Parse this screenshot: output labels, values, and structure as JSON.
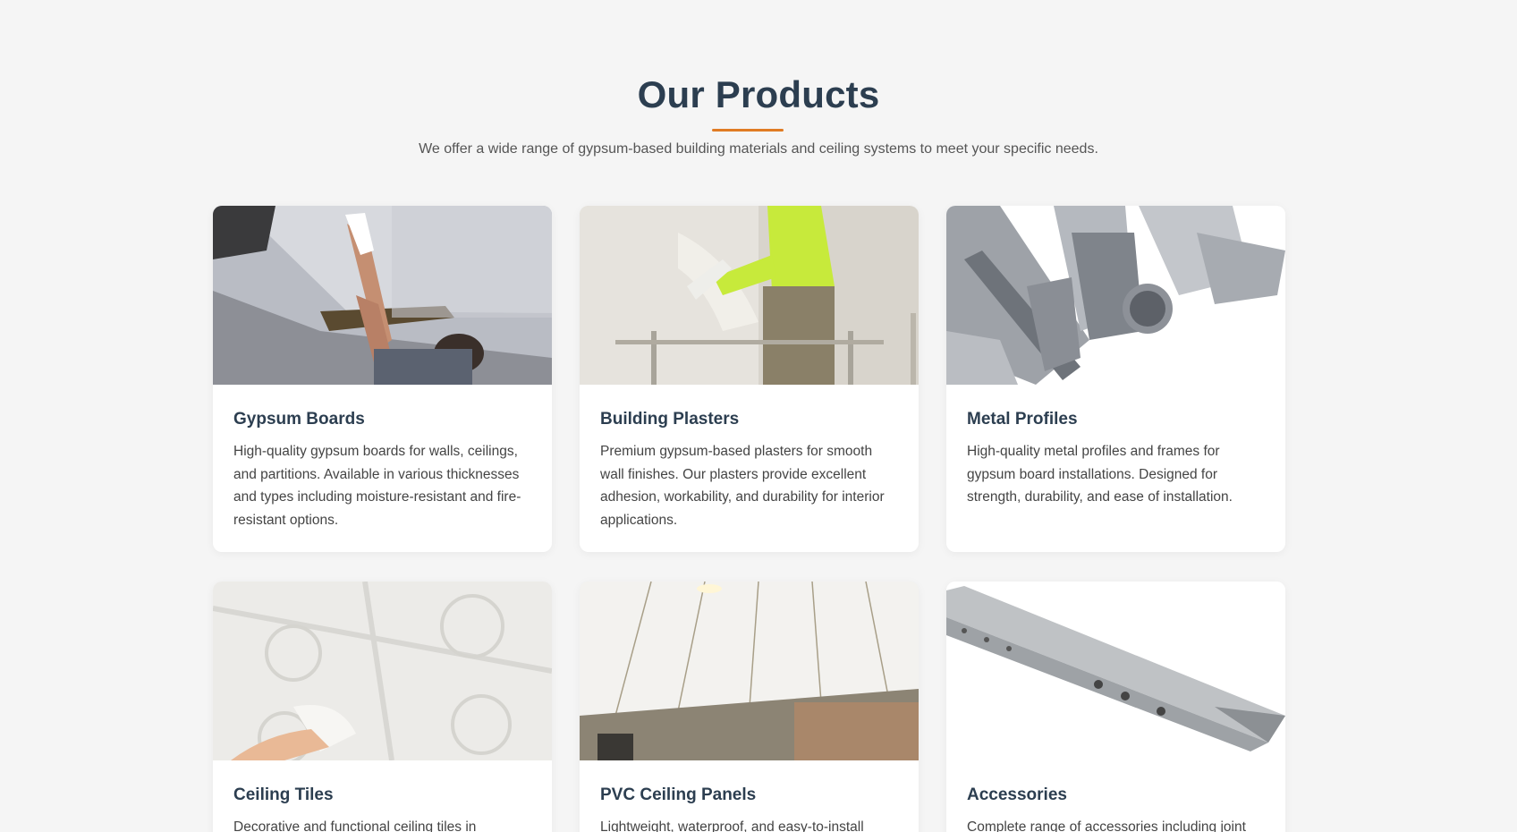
{
  "header": {
    "title": "Our Products",
    "subtitle": "We offer a wide range of gypsum-based building materials and ceiling systems to meet your specific needs.",
    "accent_color": "#e07b24",
    "title_color": "#2c3e50"
  },
  "products": [
    {
      "title": "Gypsum Boards",
      "description": "High-quality gypsum boards for walls, ceilings, and partitions. Available in various thicknesses and types including moisture-resistant and fire-resistant options.",
      "image_icon": "worker-installing-ceiling-board-image"
    },
    {
      "title": "Building Plasters",
      "description": "Premium gypsum-based plasters for smooth wall finishes. Our plasters provide excellent adhesion, workability, and durability for interior applications.",
      "image_icon": "worker-plastering-wall-image"
    },
    {
      "title": "Metal Profiles",
      "description": "High-quality metal profiles and frames for gypsum board installations. Designed for strength, durability, and ease of installation.",
      "image_icon": "metal-profiles-image"
    },
    {
      "title": "Ceiling Tiles",
      "description": "Decorative and functional ceiling tiles in",
      "image_icon": "decorative-ceiling-tiles-image"
    },
    {
      "title": "PVC Ceiling Panels",
      "description": "Lightweight, waterproof, and easy-to-install",
      "image_icon": "pvc-ceiling-panels-image"
    },
    {
      "title": "Accessories",
      "description": "Complete range of accessories including joint",
      "image_icon": "corner-bead-accessory-image"
    }
  ]
}
